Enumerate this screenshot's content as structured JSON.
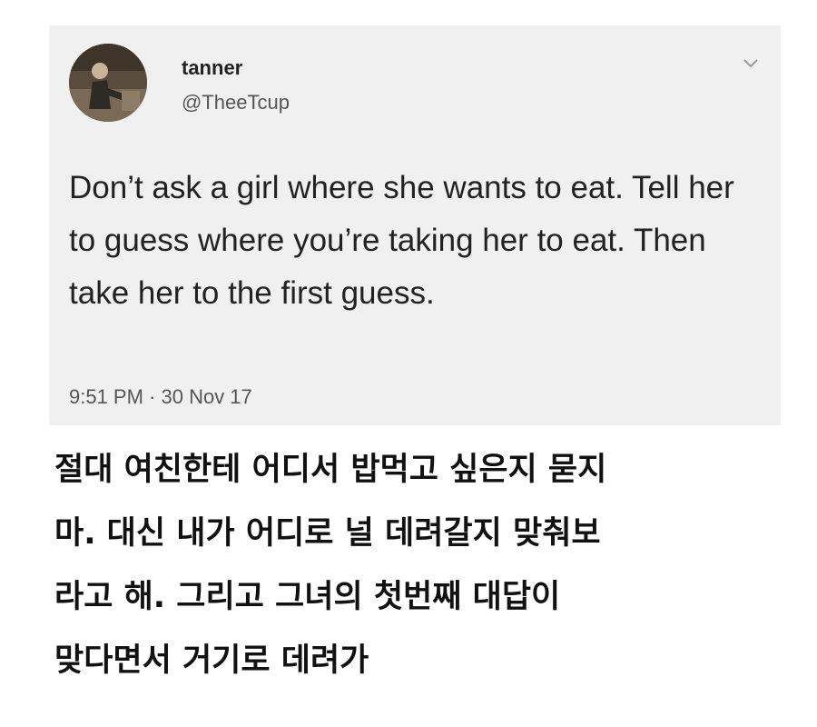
{
  "tweet": {
    "name": "tanner",
    "handle": "@TheeTcup",
    "text": "Don’t ask a girl where she wants to eat. Tell her to guess where you’re taking her to eat. Then take her to the first guess.",
    "time": "9:51 PM · 30 Nov 17",
    "menu_icon": "chevron-down-icon",
    "avatar_icon": "user-photo"
  },
  "caption": {
    "lines": [
      "절대 여친한테 어디서 밥먹고 싶은지 묻지",
      "마. 대신 내가 어디로 널 데려갈지 맞춰보",
      "라고 해. 그리고 그녀의 첫번째 대답이",
      "맞다면서 거기로 데려가"
    ]
  },
  "colors": {
    "card_background": "#f0f0f0",
    "text_primary": "#222222",
    "text_secondary": "#555555"
  }
}
